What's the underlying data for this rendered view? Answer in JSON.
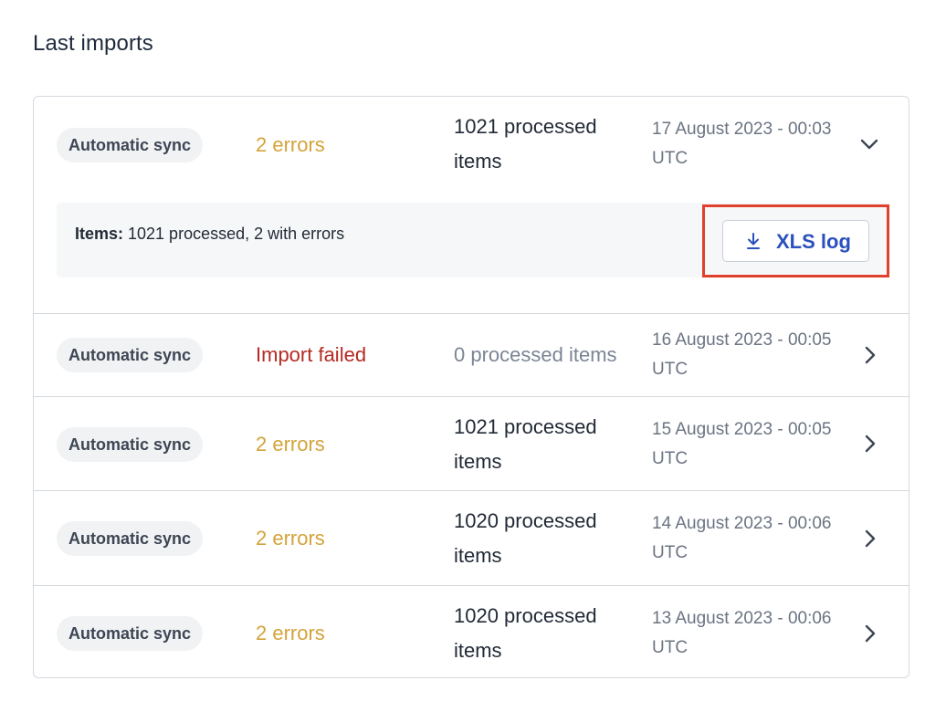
{
  "page_title": "Last imports",
  "expanded": {
    "source": "Automatic sync",
    "status": "2 errors",
    "processed_line1": "1021 processed",
    "processed_line2": "items",
    "date_line1": "17 August 2023 - 00:03",
    "date_line2": "UTC",
    "details_label": "Items:",
    "details_value": " 1021 processed, 2 with errors",
    "xls_button_label": "XLS log",
    "chevron_icon": "chevron-down-icon",
    "download_icon": "download-icon"
  },
  "rows": [
    {
      "source": "Automatic sync",
      "status": "Import failed",
      "status_type": "failed",
      "processed": "0 processed items",
      "date_line1": "16 August 2023 - 00:05",
      "date_line2": "UTC",
      "chevron_icon": "chevron-right-icon"
    },
    {
      "source": "Automatic sync",
      "status": "2 errors",
      "status_type": "warning",
      "processed_line1": "1021 processed",
      "processed_line2": "items",
      "date_line1": "15 August 2023 - 00:05",
      "date_line2": "UTC",
      "chevron_icon": "chevron-right-icon"
    },
    {
      "source": "Automatic sync",
      "status": "2 errors",
      "status_type": "warning",
      "processed_line1": "1020 processed",
      "processed_line2": "items",
      "date_line1": "14 August 2023 - 00:06",
      "date_line2": "UTC",
      "chevron_icon": "chevron-right-icon"
    },
    {
      "source": "Automatic sync",
      "status": "2 errors",
      "status_type": "warning",
      "processed_line1": "1020 processed",
      "processed_line2": "items",
      "date_line1": "13 August 2023 - 00:06",
      "date_line2": "UTC",
      "chevron_icon": "chevron-right-icon"
    }
  ],
  "colors": {
    "warning": "#d4a33a",
    "failed": "#b52a22",
    "link": "#2a50bd",
    "highlight": "#e0412c"
  }
}
